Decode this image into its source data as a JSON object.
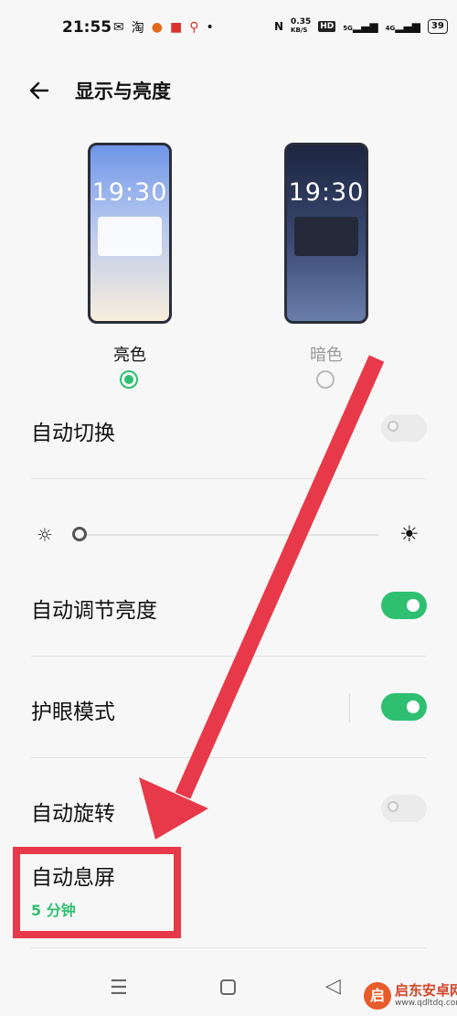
{
  "status_bar": {
    "time": "21:55",
    "left_icons": [
      "wechat-icon",
      "taobao-icon",
      "app-icon",
      "app-icon",
      "location-icon"
    ],
    "dot": "•",
    "nfc": "N",
    "net_speed": "0.35",
    "net_unit": "KB/S",
    "hd": "HD",
    "sig1": "5G",
    "sig2": "4G",
    "battery": "39"
  },
  "header": {
    "title": "显示与亮度"
  },
  "theme": {
    "options": [
      {
        "label": "亮色",
        "preview_time": "19:30",
        "selected": true
      },
      {
        "label": "暗色",
        "preview_time": "19:30",
        "selected": false
      }
    ]
  },
  "settings": {
    "auto_switch": {
      "label": "自动切换",
      "on": false
    },
    "auto_brightness": {
      "label": "自动调节亮度",
      "on": true
    },
    "eye_comfort": {
      "label": "护眼模式",
      "on": true
    },
    "auto_rotate": {
      "label": "自动旋转",
      "on": false
    },
    "screen_timeout": {
      "label": "自动息屏",
      "value": "5 分钟"
    }
  },
  "brightness": {
    "level": 0.0
  },
  "watermark": {
    "logo": "启",
    "name": "启东安卓网",
    "url": "www.qdltdq.com"
  },
  "colors": {
    "accent": "#2fbf71",
    "annotation": "#e8394a"
  }
}
